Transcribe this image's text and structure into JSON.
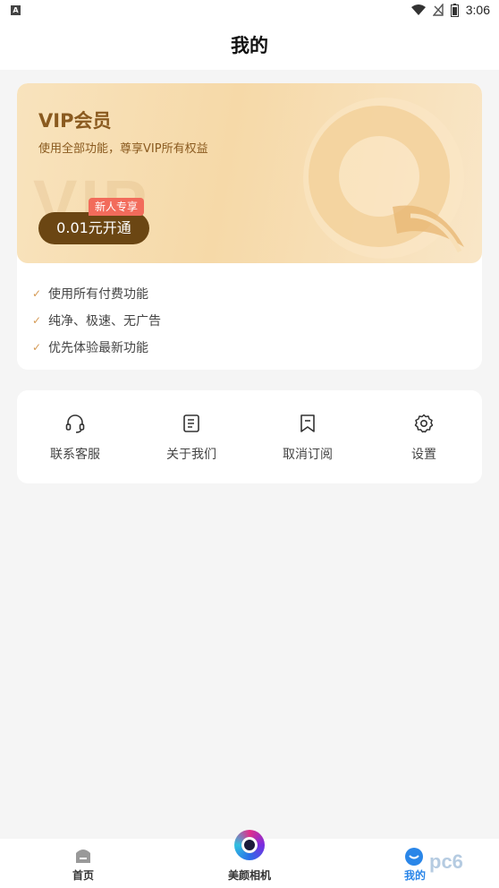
{
  "status_bar": {
    "time": "3:06"
  },
  "header": {
    "title": "我的"
  },
  "vip": {
    "title": "VIP会员",
    "subtitle": "使用全部功能，尊享VIP所有权益",
    "bg_text": "VIP",
    "badge": "新人专享",
    "button": "0.01元开通",
    "features": [
      "使用所有付费功能",
      "纯净、极速、无广告",
      "优先体验最新功能"
    ]
  },
  "menu": [
    {
      "label": "联系客服",
      "icon": "headset-icon"
    },
    {
      "label": "关于我们",
      "icon": "document-icon"
    },
    {
      "label": "取消订阅",
      "icon": "bookmark-icon"
    },
    {
      "label": "设置",
      "icon": "gear-icon"
    }
  ],
  "tabs": [
    {
      "label": "首页",
      "icon": "home-icon"
    },
    {
      "label": "美颜相机",
      "icon": "camera-circle-icon"
    },
    {
      "label": "我的",
      "icon": "profile-icon",
      "active": true
    }
  ],
  "watermark": "pc6",
  "colors": {
    "accent": "#2a86e8",
    "vip_brown": "#6b4613",
    "badge_red": "#f26b5b"
  }
}
